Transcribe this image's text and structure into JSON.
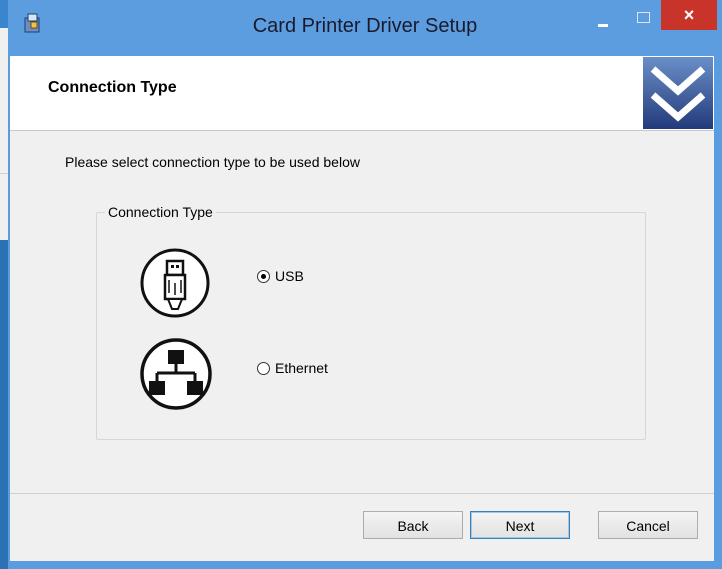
{
  "window": {
    "title": "Card Printer Driver Setup",
    "close_glyph": "×"
  },
  "header": {
    "title": "Connection Type"
  },
  "main": {
    "instruction": "Please select connection type to be used below",
    "group_label": "Connection Type",
    "options": [
      {
        "label": "USB",
        "selected": true,
        "icon": "usb-icon"
      },
      {
        "label": "Ethernet",
        "selected": false,
        "icon": "ethernet-network-icon"
      }
    ]
  },
  "footer": {
    "back_label": "Back",
    "next_label": "Next",
    "cancel_label": "Cancel"
  },
  "colors": {
    "titlebar": "#5c9de0",
    "close": "#c9342a",
    "client": "#f0f0f0"
  }
}
